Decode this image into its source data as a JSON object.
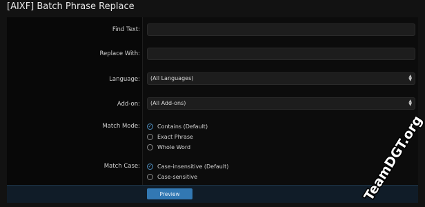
{
  "page": {
    "title": "[AIXF] Batch Phrase Replace"
  },
  "form": {
    "find_text": {
      "label": "Find Text:",
      "value": ""
    },
    "replace_with": {
      "label": "Replace With:",
      "value": ""
    },
    "language": {
      "label": "Language:",
      "selected": "(All Languages)"
    },
    "addon": {
      "label": "Add-on:",
      "selected": "(All Add-ons)"
    },
    "match_mode": {
      "label": "Match Mode:",
      "options": [
        {
          "label": "Contains (Default)",
          "checked": true
        },
        {
          "label": "Exact Phrase",
          "checked": false
        },
        {
          "label": "Whole Word",
          "checked": false
        }
      ]
    },
    "match_case": {
      "label": "Match Case:",
      "options": [
        {
          "label": "Case-insensitive (Default)",
          "checked": true
        },
        {
          "label": "Case-sensitive",
          "checked": false
        }
      ]
    },
    "preview_label": "Preview"
  },
  "watermark": {
    "text": "TeamDGT.org"
  },
  "colors": {
    "accent": "#3278b3",
    "check": "#4f8fc0",
    "background": "#121212",
    "field": "#1d1d1d"
  }
}
